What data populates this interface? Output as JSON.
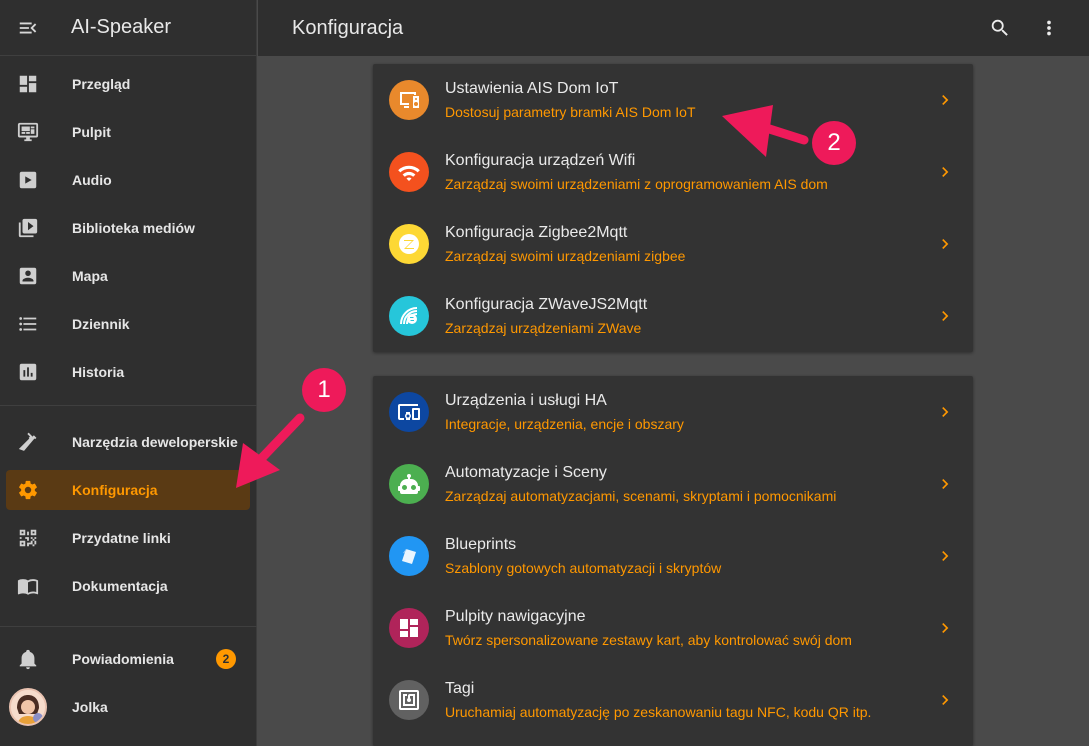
{
  "app": {
    "title": "AI-Speaker"
  },
  "header": {
    "title": "Konfiguracja"
  },
  "sidebar": {
    "items": [
      {
        "label": "Przegląd",
        "icon": "dashboard-icon"
      },
      {
        "label": "Pulpit",
        "icon": "monitor-dashboard-icon"
      },
      {
        "label": "Audio",
        "icon": "play-box-icon"
      },
      {
        "label": "Biblioteka mediów",
        "icon": "play-box-multiple-icon"
      },
      {
        "label": "Mapa",
        "icon": "account-box-icon"
      },
      {
        "label": "Dziennik",
        "icon": "format-list-bulleted-icon"
      },
      {
        "label": "Historia",
        "icon": "chart-box-icon"
      },
      {
        "label": "Narzędzia deweloperskie",
        "icon": "hammer-icon"
      },
      {
        "label": "Konfiguracja",
        "icon": "cog-icon",
        "active": true
      },
      {
        "label": "Przydatne linki",
        "icon": "qrcode-icon"
      },
      {
        "label": "Dokumentacja",
        "icon": "book-open-icon"
      }
    ],
    "notifications": {
      "label": "Powiadomienia",
      "count": "2",
      "icon": "bell-icon"
    },
    "user": {
      "label": "Jolka"
    }
  },
  "cards": [
    {
      "rows": [
        {
          "title": "Ustawienia AIS Dom IoT",
          "subtitle": "Dostosuj parametry bramki AIS Dom IoT",
          "icon": "monitor-speaker-icon",
          "color": "#e9892c"
        },
        {
          "title": "Konfiguracja urządzeń Wifi",
          "subtitle": "Zarządzaj swoimi urządzeniami z oprogramowaniem AIS dom",
          "icon": "wifi-icon",
          "color": "#f4511e"
        },
        {
          "title": "Konfiguracja Zigbee2Mqtt",
          "subtitle": "Zarządzaj swoimi urządzeniami zigbee",
          "icon": "zigbee-icon",
          "color": "#fdd835"
        },
        {
          "title": "Konfiguracja ZWaveJS2Mqtt",
          "subtitle": "Zarządzaj urządzeniami ZWave",
          "icon": "zwave-icon",
          "color": "#26c6da"
        }
      ]
    },
    {
      "rows": [
        {
          "title": "Urządzenia i usługi HA",
          "subtitle": "Integracje, urządzenia, encje i obszary",
          "icon": "devices-icon",
          "color": "#0d47a1"
        },
        {
          "title": "Automatyzacje i Sceny",
          "subtitle": "Zarządzaj automatyzacjami, scenami, skryptami i pomocnikami",
          "icon": "robot-icon",
          "color": "#4caf50"
        },
        {
          "title": "Blueprints",
          "subtitle": "Szablony gotowych automatyzacji i skryptów",
          "icon": "blueprint-icon",
          "color": "#2196f3"
        },
        {
          "title": "Pulpity nawigacyjne",
          "subtitle": "Twórz spersonalizowane zestawy kart, aby kontrolować swój dom",
          "icon": "view-dashboard-icon",
          "color": "#b0245a"
        },
        {
          "title": "Tagi",
          "subtitle": "Uruchamiaj automatyzację po zeskanowaniu tagu NFC, kodu QR itp.",
          "icon": "nfc-icon",
          "color": "#616161"
        }
      ]
    }
  ],
  "annotations": {
    "first": "1",
    "second": "2",
    "color": "#ee1a5a"
  }
}
